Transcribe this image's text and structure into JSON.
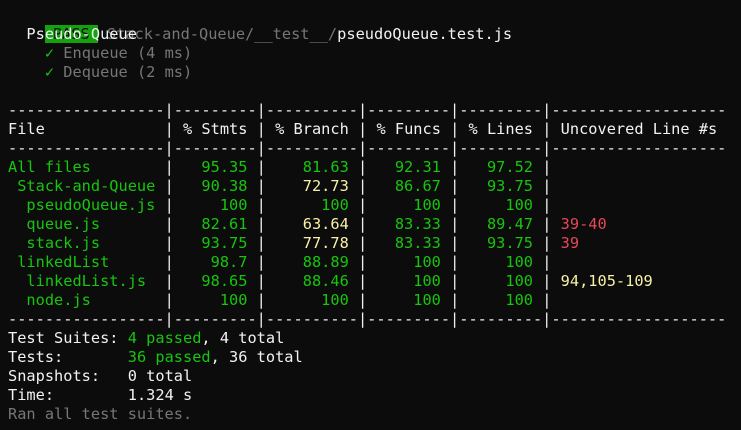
{
  "header": {
    "badge": "PASS",
    "path_dim": "Stack-and-Queue/__test__/",
    "path_file": "pseudoQueue.test.js"
  },
  "suite": {
    "name": "Pseudo-Queue",
    "tests": [
      {
        "check": "✓",
        "label": "Enqueue (4 ms)"
      },
      {
        "check": "✓",
        "label": "Dequeue (2 ms)"
      }
    ]
  },
  "coverage": {
    "divider": "-----------------|---------|----------|---------|---------|-------------------",
    "headers": [
      "File",
      "% Stmts",
      "% Branch",
      "% Funcs",
      "% Lines",
      "Uncovered Line #s"
    ],
    "rows": [
      {
        "file": "All files",
        "indent": 0,
        "stmts": "95.35",
        "branch": "81.63",
        "funcs": "92.31",
        "lines": "97.52",
        "uncovered": "",
        "branch_warn": false,
        "unc_color": ""
      },
      {
        "file": "Stack-and-Queue",
        "indent": 1,
        "stmts": "90.38",
        "branch": "72.73",
        "funcs": "86.67",
        "lines": "93.75",
        "uncovered": "",
        "branch_warn": true,
        "unc_color": ""
      },
      {
        "file": "pseudoQueue.js",
        "indent": 2,
        "stmts": "100",
        "branch": "100",
        "funcs": "100",
        "lines": "100",
        "uncovered": "",
        "branch_warn": false,
        "unc_color": ""
      },
      {
        "file": "queue.js",
        "indent": 2,
        "stmts": "82.61",
        "branch": "63.64",
        "funcs": "83.33",
        "lines": "89.47",
        "uncovered": "39-40",
        "branch_warn": true,
        "unc_color": "red"
      },
      {
        "file": "stack.js",
        "indent": 2,
        "stmts": "93.75",
        "branch": "77.78",
        "funcs": "83.33",
        "lines": "93.75",
        "uncovered": "39",
        "branch_warn": true,
        "unc_color": "red"
      },
      {
        "file": "linkedList",
        "indent": 1,
        "stmts": "98.7",
        "branch": "88.89",
        "funcs": "100",
        "lines": "100",
        "uncovered": "",
        "branch_warn": false,
        "unc_color": ""
      },
      {
        "file": "linkedList.js",
        "indent": 2,
        "stmts": "98.65",
        "branch": "88.46",
        "funcs": "100",
        "lines": "100",
        "uncovered": "94,105-109",
        "branch_warn": false,
        "unc_color": "yellow"
      },
      {
        "file": "node.js",
        "indent": 2,
        "stmts": "100",
        "branch": "100",
        "funcs": "100",
        "lines": "100",
        "uncovered": "",
        "branch_warn": false,
        "unc_color": ""
      }
    ]
  },
  "summary": {
    "suites_label": "Test Suites:",
    "suites_passed": "4 passed",
    "suites_total": ", 4 total",
    "tests_label": "Tests:",
    "tests_passed": "36 passed",
    "tests_total": ", 36 total",
    "snapshots_label": "Snapshots:",
    "snapshots_value": "0 total",
    "time_label": "Time:",
    "time_value": "1.324 s",
    "footer": "Ran all test suites."
  },
  "colors": {
    "background": "#0c0c0c",
    "pass_badge": "#13a10e",
    "green": "#16c60c",
    "yellow": "#f9f1a5",
    "red": "#e74856",
    "dim": "#767676"
  }
}
